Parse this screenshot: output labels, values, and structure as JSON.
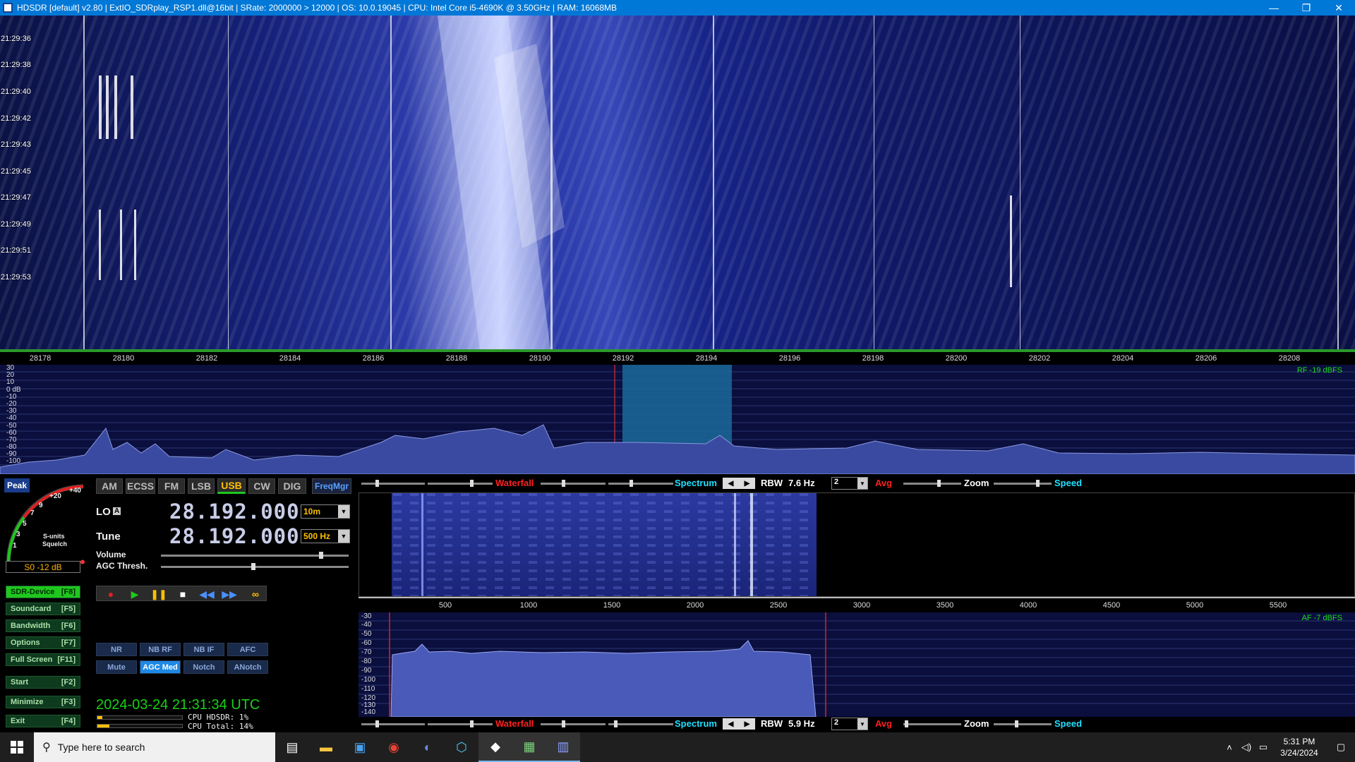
{
  "window": {
    "title": "HDSDR [default] v2.80  | ExtIO_SDRplay_RSP1.dll@16bit | SRate: 2000000 > 12000 | OS: 10.0.19045 | CPU: Intel Core i5-4690K @ 3.50GHz | RAM: 16068MB",
    "minimize": "—",
    "restore": "❐",
    "close": "✕"
  },
  "waterfall": {
    "times": [
      "21:29:36",
      "21:29:38",
      "21:29:40",
      "21:29:42",
      "21:29:43",
      "21:29:45",
      "21:29:47",
      "21:29:49",
      "21:29:51",
      "21:29:53"
    ]
  },
  "freq_scale": {
    "ticks": [
      "28178",
      "28180",
      "28182",
      "28184",
      "28186",
      "28188",
      "28190",
      "28192",
      "28194",
      "28196",
      "28198",
      "28200",
      "28202",
      "28204",
      "28206",
      "28208"
    ]
  },
  "spectrum": {
    "db_labels": [
      "30",
      "20",
      "10",
      "0 dB",
      "-10",
      "-20",
      "-30",
      "-40",
      "-50",
      "-60",
      "-70",
      "-80",
      "-90",
      "-100"
    ],
    "rf_readout": "RF -19 dBFS"
  },
  "smeter": {
    "peak": "Peak",
    "scale_labels": [
      "+40",
      "+20",
      "9",
      "7",
      "5",
      "3",
      "1"
    ],
    "units_label": "S-units",
    "squelch_label": "Squelch",
    "readout": "S0 -12 dB"
  },
  "modes": {
    "items": [
      "AM",
      "ECSS",
      "FM",
      "LSB",
      "USB",
      "CW",
      "DIG"
    ],
    "active": "USB",
    "freqmgr": "FreqMgr"
  },
  "lo": {
    "label": "LO",
    "badge": "A",
    "value": "28.192.000",
    "band": "10m"
  },
  "tune": {
    "label": "Tune",
    "value": "28.192.000",
    "step": "500 Hz"
  },
  "volume_label": "Volume",
  "agc_label": "AGC Thresh.",
  "side_buttons": [
    {
      "label": "SDR-Device",
      "key": "[F8]"
    },
    {
      "label": "Soundcard",
      "key": "[F5]"
    },
    {
      "label": "Bandwidth",
      "key": "[F6]"
    },
    {
      "label": "Options",
      "key": "[F7]"
    },
    {
      "label": "Full Screen",
      "key": "[F11]"
    },
    {
      "label": "Start",
      "key": "[F2]"
    },
    {
      "label": "Minimize",
      "key": "[F3]"
    },
    {
      "label": "Exit",
      "key": "[F4]"
    }
  ],
  "dsp": {
    "row1": [
      "NR",
      "NB RF",
      "NB IF",
      "AFC"
    ],
    "row2": [
      "Mute",
      "AGC Med",
      "Notch",
      "ANotch"
    ]
  },
  "status": {
    "datetime": "2024-03-24   21:31:34 UTC",
    "cpu_hdsdr": "CPU HDSDR: 1%",
    "cpu_total": "CPU Total: 14%",
    "cpu_hdsdr_level": 0.01,
    "cpu_total_level": 0.14
  },
  "toolbar_rf": {
    "waterfall": "Waterfall",
    "spectrum": "Spectrum",
    "rbw_label": "RBW",
    "rbw_value": "7.6 Hz",
    "avg_value": "2",
    "avg_label": "Avg",
    "zoom": "Zoom",
    "speed": "Speed"
  },
  "af_scale": {
    "ticks": [
      "500",
      "1000",
      "1500",
      "2000",
      "2500",
      "3000",
      "3500",
      "4000",
      "4500",
      "5000",
      "5500"
    ]
  },
  "af_spectrum": {
    "db_labels": [
      "-30",
      "-40",
      "-50",
      "-60",
      "-70",
      "-80",
      "-90",
      "-100",
      "-110",
      "-120",
      "-130",
      "-140"
    ],
    "af_readout": "AF -7 dBFS"
  },
  "toolbar_af": {
    "waterfall": "Waterfall",
    "spectrum": "Spectrum",
    "rbw_label": "RBW",
    "rbw_value": "5.9 Hz",
    "avg_value": "2",
    "avg_label": "Avg",
    "zoom": "Zoom",
    "speed": "Speed"
  },
  "taskbar": {
    "search_placeholder": "Type here to search",
    "time": "5:31 PM",
    "date": "3/24/2024"
  },
  "colors": {
    "accent": "#0078d7",
    "waterfall_bg": "#0a0f3a",
    "spectrum_bg": "#0b0f3e",
    "green": "#18d018",
    "amber": "#ffc000"
  }
}
